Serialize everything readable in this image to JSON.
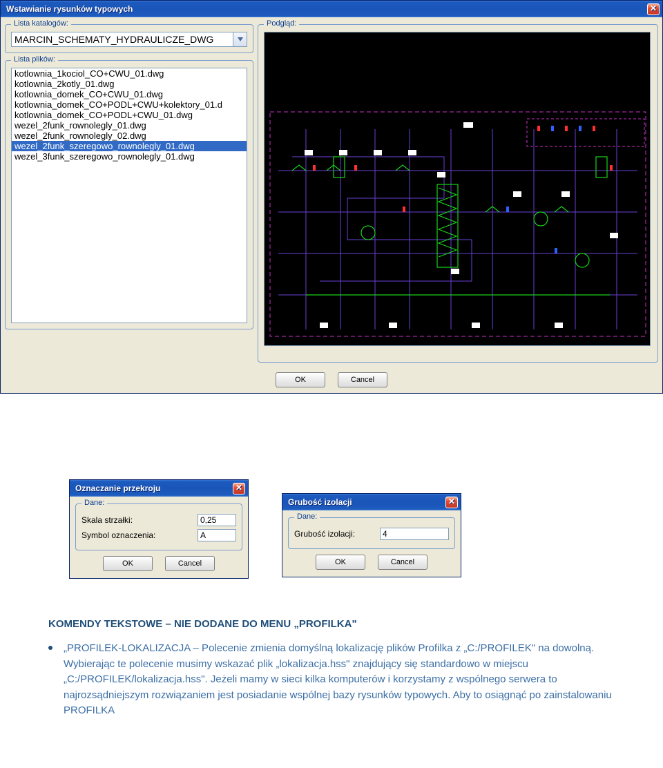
{
  "mainWindow": {
    "title": "Wstawianie rysunków typowych",
    "catalogLabel": "Lista katalogów:",
    "catalogValue": "MARCIN_SCHEMATY_HYDRAULICZE_DWG",
    "fileListLabel": "Lista plików:",
    "files": {
      "0": "kotlownia_1kociol_CO+CWU_01.dwg",
      "1": "kotlownia_2kotly_01.dwg",
      "2": "kotlownia_domek_CO+CWU_01.dwg",
      "3": "kotlownia_domek_CO+PODL+CWU+kolektory_01.d",
      "4": "kotlownia_domek_CO+PODL+CWU_01.dwg",
      "5": "wezel_2funk_rownolegly_01.dwg",
      "6": "wezel_2funk_rownolegly_02.dwg",
      "7": "wezel_2funk_szeregowo_rownolegly_01.dwg",
      "8": "wezel_3funk_szeregowo_rownolegly_01.dwg"
    },
    "previewLabel": "Podgląd:",
    "ok": "OK",
    "cancel": "Cancel"
  },
  "przekrojWindow": {
    "title": "Oznaczanie przekroju",
    "groupLabel": "Dane:",
    "skalaLabel": "Skala strzałki:",
    "skalaValue": "0,25",
    "symbolLabel": "Symbol oznaczenia:",
    "symbolValue": "A",
    "ok": "OK",
    "cancel": "Cancel"
  },
  "gruboscWindow": {
    "title": "Grubość izolacji",
    "groupLabel": "Dane:",
    "gruboscLabel": "Grubość izolacji:",
    "gruboscValue": "4",
    "ok": "OK",
    "cancel": "Cancel"
  },
  "doc": {
    "heading": "KOMENDY TEKSTOWE – NIE DODANE DO MENU „PROFILKA\"",
    "bullet": "„PROFILEK-LOKALIZACJA – Polecenie zmienia domyślną lokalizację plików Profilka z „C:/PROFILEK\" na dowolną. Wybierając te polecenie musimy wskazać plik „lokalizacja.hss\" znajdujący się standardowo w miejscu „C:/PROFILEK/lokalizacja.hss\". Jeżeli mamy w sieci kilka komputerów i korzystamy z wspólnego serwera to najrozsądniejszym rozwiązaniem jest posiadanie wspólnej bazy rysunków typowych. Aby to osiągnąć po zainstalowaniu PROFILKA"
  },
  "colors": {
    "titlebar": "#1e5bbf",
    "close": "#e74b2c",
    "selection": "#316ac5",
    "docText": "#3b6ea5"
  }
}
